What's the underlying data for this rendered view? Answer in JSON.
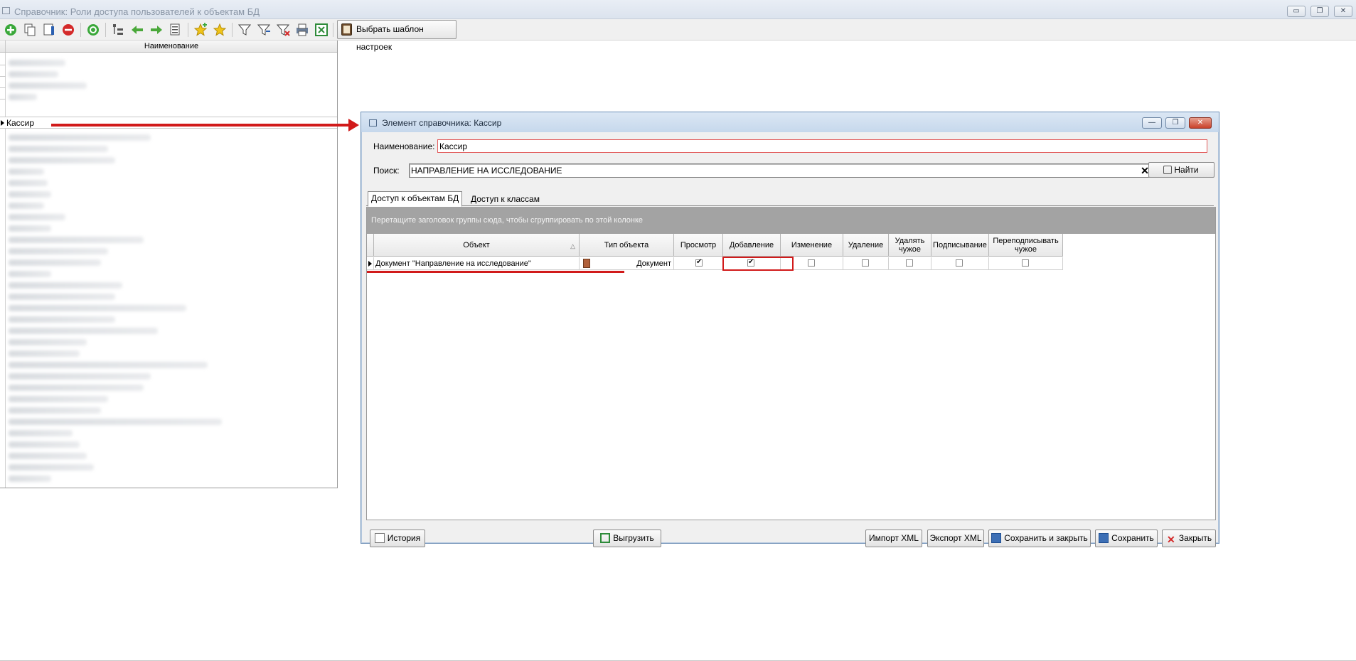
{
  "main_window": {
    "title": "Справочник: Роли доступа пользователей к объектам БД",
    "controls": {
      "minimize": "▭",
      "restore": "❐",
      "close": "✕"
    }
  },
  "toolbar": {
    "buttons": [
      "add-icon",
      "copy-icon",
      "edit-icon",
      "delete-icon",
      "refresh-icon",
      "tree-icon",
      "back-arrow-icon",
      "forward-arrow-icon",
      "list-icon",
      "star-add-icon",
      "star-icon",
      "filter-icon",
      "filter-edit-icon",
      "filter-clear-icon",
      "print-icon",
      "excel-icon"
    ],
    "template_button": "Выбрать шаблон настроек"
  },
  "left_list": {
    "header": "Наименование",
    "selected_item": "Кассир"
  },
  "dialog": {
    "title": "Элемент справочника: Кассир",
    "controls": {
      "minimize": "—",
      "restore": "❐",
      "close": "✕"
    },
    "name_label": "Наименование:",
    "name_value": "Кассир",
    "search_label": "Поиск:",
    "search_value": "НАПРАВЛЕНИЕ НА ИССЛЕДОВАНИЕ",
    "find_button": "Найти",
    "tabs": [
      "Доступ к объектам БД",
      "Доступ к классам"
    ],
    "group_panel_text": "Перетащите заголовок группы сюда, чтобы сгруппировать по этой колонке",
    "columns": [
      "Объект",
      "Тип объекта",
      "Просмотр",
      "Добавление",
      "Изменение",
      "Удаление",
      "Удалять чужое",
      "Подписывание",
      "Переподписывать чужое"
    ],
    "row": {
      "object": "Документ \"Направление на исследование\"",
      "type": "Документ",
      "view": true,
      "add": true,
      "edit": false,
      "delete": false,
      "delete_others": false,
      "sign": false,
      "resign_others": false
    },
    "footer": {
      "history": "История",
      "export": "Выгрузить",
      "import_xml": "Импорт XML",
      "export_xml": "Экспорт XML",
      "save_close": "Сохранить и закрыть",
      "save": "Сохранить",
      "close": "Закрыть"
    }
  },
  "colors": {
    "accent_red": "#d11a1a",
    "title_blue": "#c6d8ec",
    "group_panel": "#a3a3a3"
  }
}
